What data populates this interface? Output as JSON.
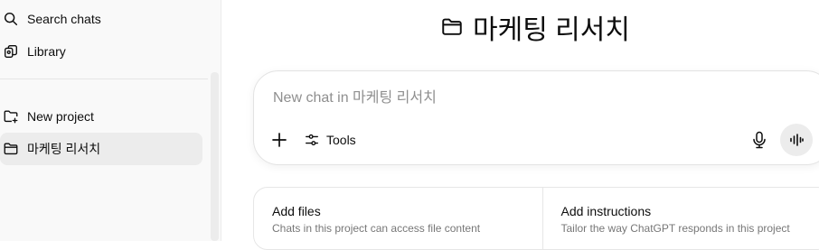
{
  "sidebar": {
    "items": [
      {
        "label": "Search chats",
        "icon": "search-icon"
      },
      {
        "label": "Library",
        "icon": "library-icon"
      },
      {
        "label": "New project",
        "icon": "folder-plus-icon"
      },
      {
        "label": "마케팅 리서치",
        "icon": "folder-icon"
      }
    ]
  },
  "main": {
    "title": "마케팅 리서치",
    "composer": {
      "placeholder": "New chat in 마케팅 리서치",
      "tools_label": "Tools"
    },
    "cards": [
      {
        "title": "Add files",
        "subtitle": "Chats in this project can access file content"
      },
      {
        "title": "Add instructions",
        "subtitle": "Tailor the way ChatGPT responds in this project"
      }
    ]
  },
  "colors": {
    "sidebar_bg": "#f9f9f9",
    "active_item_bg": "#ececec",
    "placeholder": "#8f8f8f",
    "muted_text": "#777777"
  }
}
